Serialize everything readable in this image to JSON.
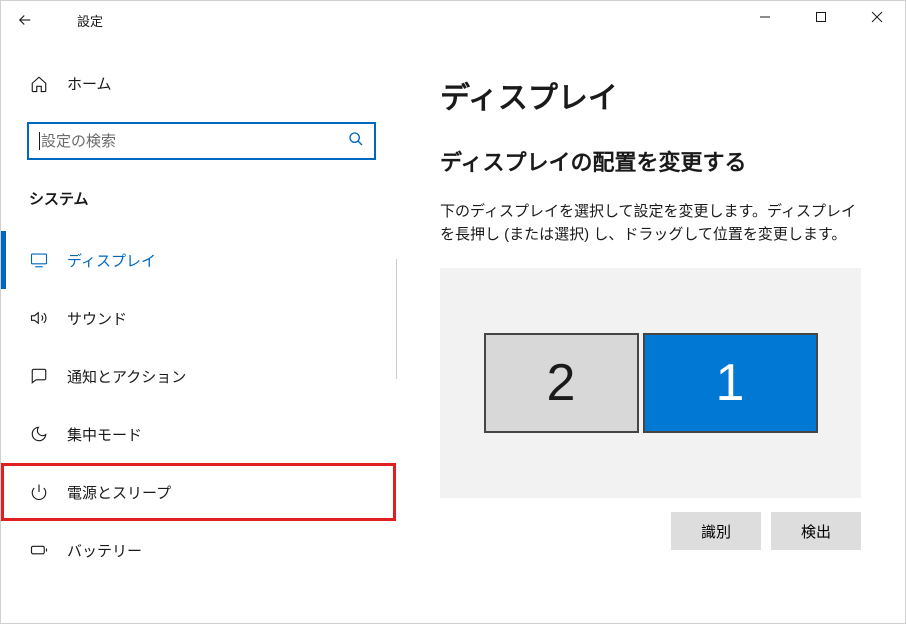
{
  "window": {
    "title": "設定"
  },
  "sidebar": {
    "home_label": "ホーム",
    "search_placeholder": "設定の検索",
    "section_label": "システム",
    "items": [
      {
        "label": "ディスプレイ"
      },
      {
        "label": "サウンド"
      },
      {
        "label": "通知とアクション"
      },
      {
        "label": "集中モード"
      },
      {
        "label": "電源とスリープ"
      },
      {
        "label": "バッテリー"
      }
    ]
  },
  "main": {
    "page_title": "ディスプレイ",
    "section_title": "ディスプレイの配置を変更する",
    "description": "下のディスプレイを選択して設定を変更します。ディスプレイを長押し (または選択) し、ドラッグして位置を変更します。",
    "monitors": {
      "left": "2",
      "right": "1"
    },
    "buttons": {
      "identify": "識別",
      "detect": "検出"
    }
  }
}
